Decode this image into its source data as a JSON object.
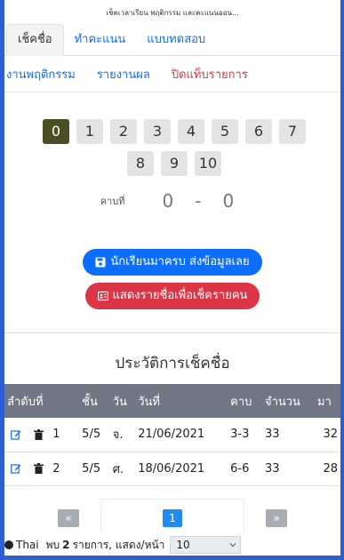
{
  "window_title": "เช็คเวลาเรียน พฤติกรรม และคะแนนออน...",
  "tabs": [
    {
      "label": "เช็คชื่อ"
    },
    {
      "label": "ทำคะแนน"
    },
    {
      "label": "แบบทดสอบ"
    }
  ],
  "subnav": {
    "behavior": "งานพฤติกรรม",
    "report": "รายงานผล",
    "close_tab": "ปิดแท็บรายการ"
  },
  "number_buttons": [
    "0",
    "1",
    "2",
    "3",
    "4",
    "5",
    "6",
    "7",
    "8",
    "9",
    "10"
  ],
  "period": {
    "label": "คาบที่",
    "from": "0",
    "dash": "-",
    "to": "0"
  },
  "actions": {
    "submit_all": "นักเรียนมาครบ ส่งข้อมูลเลย",
    "show_list": "แสดงรายชื่อเพื่อเช็ครายคน"
  },
  "history": {
    "title": "ประวัติการเช็คชื่อ",
    "columns": [
      "ลำดับที่",
      "ชั้น",
      "วัน",
      "วันที่",
      "คาบ",
      "จำนวน",
      "มา"
    ],
    "rows": [
      {
        "no": "1",
        "class": "5/5",
        "day": "จ.",
        "date": "21/06/2021",
        "period": "3-3",
        "count": "33",
        "present": "32"
      },
      {
        "no": "2",
        "class": "5/5",
        "day": "ศ.",
        "date": "18/06/2021",
        "period": "6-6",
        "count": "33",
        "present": "28"
      }
    ]
  },
  "pagination": {
    "prev": "«",
    "current": "1",
    "next": "»"
  },
  "footer": {
    "language": "Thai",
    "found_prefix": "พบ",
    "found_count": "2",
    "found_suffix": "รายการ, แสดง/หน้า",
    "per_page": "10"
  },
  "colors": {
    "accent": "#0d6efd",
    "danger": "#dc3545",
    "frame": "#2d5fd0",
    "active_number": "#4a4e20"
  }
}
